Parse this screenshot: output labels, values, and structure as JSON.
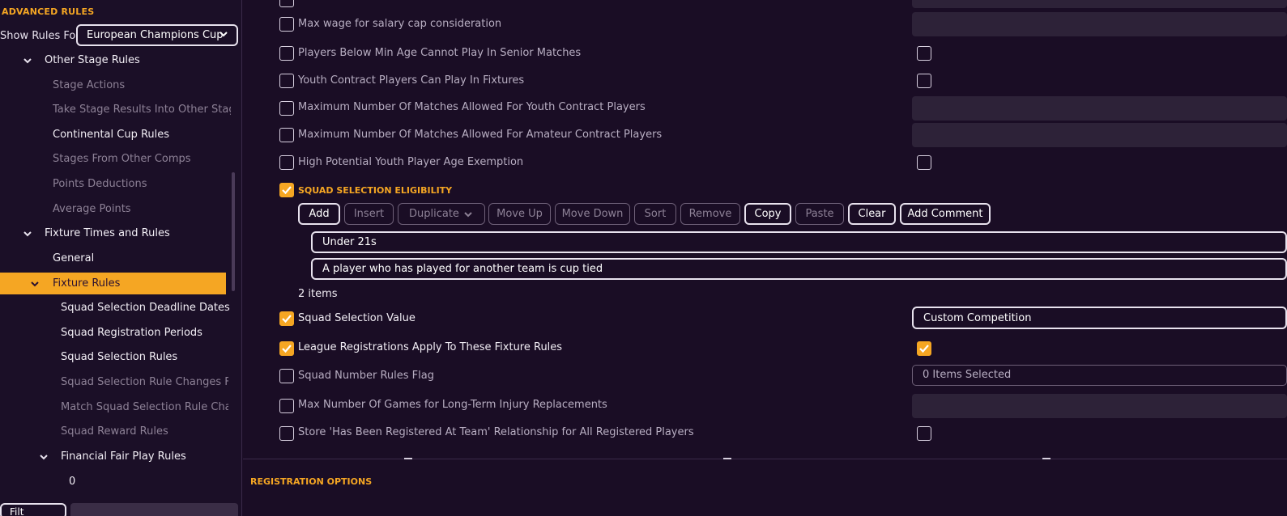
{
  "sidebar": {
    "title": "ADVANCED RULES",
    "show_rules_label": "Show Rules For",
    "competition_select": "European Champions Cup",
    "items": [
      {
        "label": "Other Stage Rules"
      },
      {
        "label": "Stage Actions"
      },
      {
        "label": "Take Stage Results Into Other Stage"
      },
      {
        "label": "Continental Cup Rules"
      },
      {
        "label": "Stages From Other Comps"
      },
      {
        "label": "Points Deductions"
      },
      {
        "label": "Average Points"
      },
      {
        "label": "Fixture Times and Rules"
      },
      {
        "label": "General"
      },
      {
        "label": "Fixture Rules"
      },
      {
        "label": "Squad Selection Deadline Dates"
      },
      {
        "label": "Squad Registration Periods"
      },
      {
        "label": "Squad Selection Rules"
      },
      {
        "label": "Squad Selection Rule Changes For"
      },
      {
        "label": "Match Squad Selection Rule Chang"
      },
      {
        "label": "Squad Reward Rules"
      },
      {
        "label": "Financial Fair Play Rules"
      },
      {
        "label": "0"
      }
    ],
    "filter_label": "Filt"
  },
  "main": {
    "rows": [
      {
        "label": "Max wage for salary cap consideration"
      },
      {
        "label": "Players Below Min Age Cannot Play In Senior Matches"
      },
      {
        "label": "Youth Contract Players Can Play In Fixtures"
      },
      {
        "label": "Maximum Number Of Matches Allowed For Youth Contract Players"
      },
      {
        "label": "Maximum Number Of Matches Allowed For Amateur Contract Players"
      },
      {
        "label": "High Potential Youth Player Age Exemption"
      }
    ],
    "squad_section": {
      "title": "SQUAD SELECTION ELIGIBILITY",
      "toolbar": {
        "add": "Add",
        "insert": "Insert",
        "duplicate": "Duplicate",
        "move_up": "Move Up",
        "move_down": "Move Down",
        "sort": "Sort",
        "remove": "Remove",
        "copy": "Copy",
        "paste": "Paste",
        "clear": "Clear",
        "add_comment": "Add Comment"
      },
      "entries": [
        "Under 21s",
        "A player who has played for another team is cup tied"
      ],
      "count": "2 items"
    },
    "rows2": [
      {
        "label": "Squad Selection Value",
        "value": "Custom Competition"
      },
      {
        "label": "League Registrations Apply To These Fixture Rules"
      },
      {
        "label": "Squad Number Rules Flag",
        "value": "0 Items Selected"
      },
      {
        "label": "Max Number Of Games for Long-Term Injury Replacements"
      },
      {
        "label": "Store 'Has Been Registered At Team' Relationship for All Registered Players"
      }
    ],
    "registration_title": "REGISTRATION OPTIONS"
  },
  "colors": {
    "accent": "#f5a623",
    "background": "#1a0d25",
    "panel": "#2d2238"
  }
}
